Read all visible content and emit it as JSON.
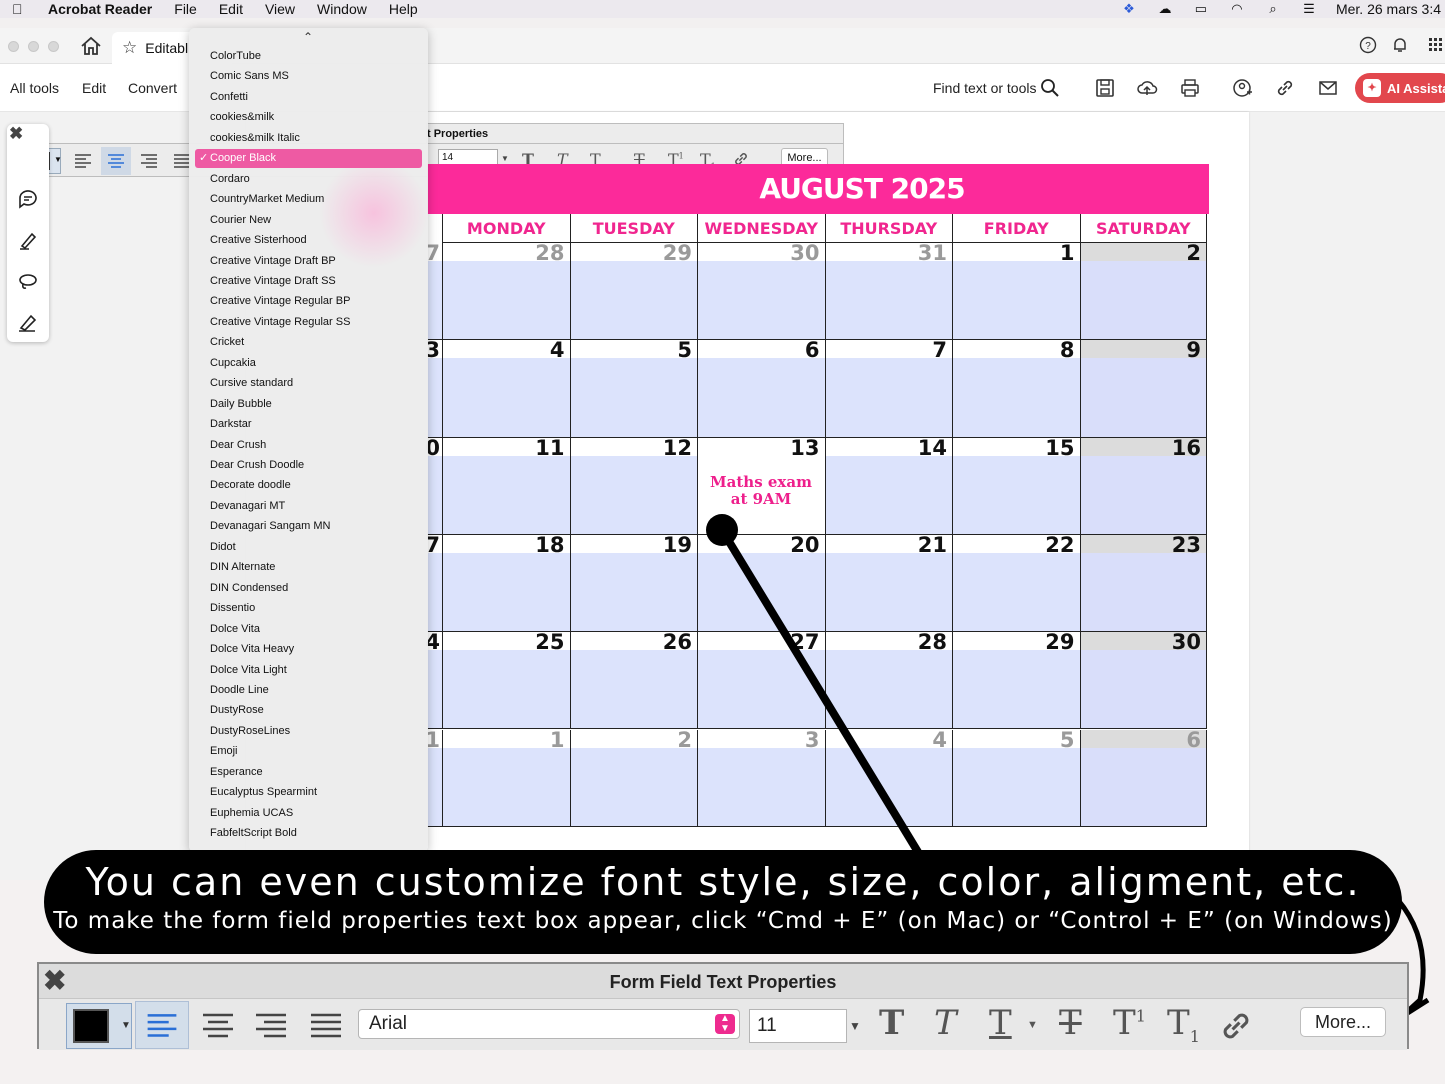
{
  "menubar": {
    "app_name": "Acrobat Reader",
    "menus": [
      "File",
      "Edit",
      "View",
      "Window",
      "Help"
    ],
    "clock": "Mer. 26 mars  3:4"
  },
  "tab": {
    "title": "Editabl"
  },
  "toolbar": {
    "menus": [
      "All tools",
      "Edit",
      "Convert"
    ],
    "find_label": "Find text or tools",
    "ai_label": "AI Assista",
    "accent": "#e2474d"
  },
  "mini_bar": {
    "title": "t Properties",
    "size": "14",
    "more": "More..."
  },
  "font_menu": {
    "selected": "Cooper Black",
    "items": [
      "ColorTube",
      "Comic Sans MS",
      "Confetti",
      "cookies&milk",
      "cookies&milk Italic",
      "Cooper Black",
      "Cordaro",
      "CountryMarket Medium",
      "Courier New",
      "Creative Sisterhood",
      "Creative Vintage Draft BP",
      "Creative Vintage Draft SS",
      "Creative Vintage Regular BP",
      "Creative Vintage Regular SS",
      "Cricket",
      "Cupcakia",
      "Cursive standard",
      "Daily Bubble",
      "Darkstar",
      "Dear Crush",
      "Dear Crush Doodle",
      "Decorate doodle",
      "Devanagari MT",
      "Devanagari Sangam MN",
      "Didot",
      "DIN Alternate",
      "DIN Condensed",
      "Dissentio",
      "Dolce Vita",
      "Dolce Vita Heavy",
      "Dolce Vita Light",
      "Doodle Line",
      "DustyRose",
      "DustyRoseLines",
      "Emoji",
      "Esperance",
      "Eucalyptus Spearmint",
      "Euphemia UCAS",
      "FabfeltScript Bold"
    ],
    "highlight": "#ee5aa3"
  },
  "calendar": {
    "title": "AUGUST 2025",
    "brand_color": "#fc2a9a",
    "days": [
      "MONDAY",
      "TUESDAY",
      "WEDNESDAY",
      "THURSDAY",
      "FRIDAY",
      "SATURDAY"
    ],
    "partial_left": [
      "7",
      "3",
      "0",
      "7",
      "4",
      "1"
    ],
    "weeks": [
      [
        {
          "n": "28",
          "m": true
        },
        {
          "n": "29",
          "m": true
        },
        {
          "n": "30",
          "m": true
        },
        {
          "n": "31",
          "m": true
        },
        {
          "n": "1",
          "m": false
        },
        {
          "n": "2",
          "m": false
        }
      ],
      [
        {
          "n": "4",
          "m": false
        },
        {
          "n": "5",
          "m": false
        },
        {
          "n": "6",
          "m": false
        },
        {
          "n": "7",
          "m": false
        },
        {
          "n": "8",
          "m": false
        },
        {
          "n": "9",
          "m": false
        }
      ],
      [
        {
          "n": "11",
          "m": false
        },
        {
          "n": "12",
          "m": false
        },
        {
          "n": "13",
          "m": false
        },
        {
          "n": "14",
          "m": false
        },
        {
          "n": "15",
          "m": false
        },
        {
          "n": "16",
          "m": false
        }
      ],
      [
        {
          "n": "18",
          "m": false
        },
        {
          "n": "19",
          "m": false
        },
        {
          "n": "20",
          "m": false
        },
        {
          "n": "21",
          "m": false
        },
        {
          "n": "22",
          "m": false
        },
        {
          "n": "23",
          "m": false
        }
      ],
      [
        {
          "n": "25",
          "m": false
        },
        {
          "n": "26",
          "m": false
        },
        {
          "n": "27",
          "m": false
        },
        {
          "n": "28",
          "m": false
        },
        {
          "n": "29",
          "m": false
        },
        {
          "n": "30",
          "m": false
        }
      ],
      [
        {
          "n": "1",
          "m": true
        },
        {
          "n": "2",
          "m": true
        },
        {
          "n": "3",
          "m": true
        },
        {
          "n": "4",
          "m": true
        },
        {
          "n": "5",
          "m": true
        },
        {
          "n": "6",
          "m": true
        }
      ]
    ],
    "event_line1": "Maths exam",
    "event_line2": "at 9AM"
  },
  "callout": {
    "title": "You can even customize font style, size, color, aligment, etc.",
    "subtitle": "To make the form field properties text box appear, click “Cmd + E” (on Mac) or “Control + E” (on Windows)"
  },
  "form_field_panel": {
    "title": "Form Field Text Properties",
    "font": "Arial",
    "size": "11",
    "more": "More..."
  }
}
